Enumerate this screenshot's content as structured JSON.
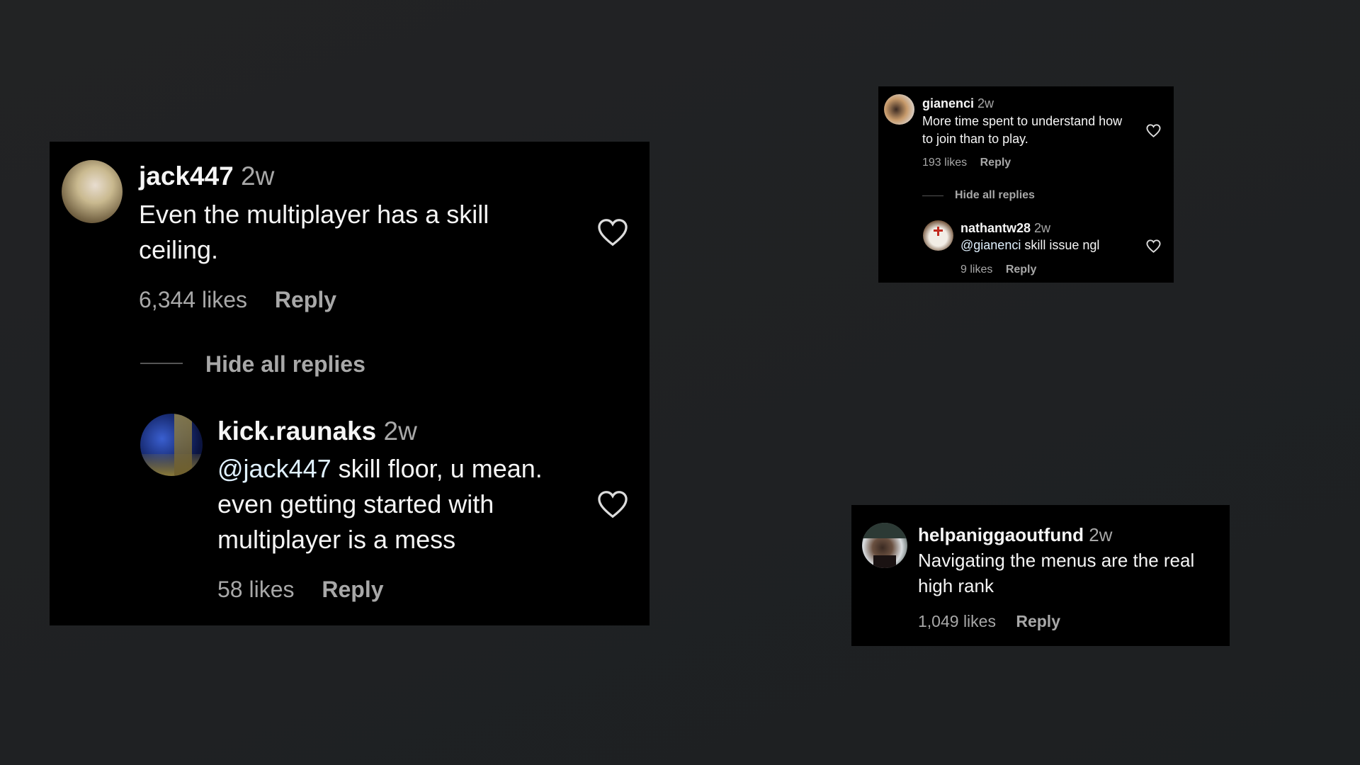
{
  "comments": [
    {
      "username": "jack447",
      "time": "2w",
      "text_lines": [
        "Even the multiplayer has a skill",
        "ceiling."
      ],
      "likes": "6,344 likes",
      "reply_label": "Reply",
      "hide_replies_label": "Hide all replies",
      "avatar_colors": [
        "#c9b98f",
        "#6b5a3c",
        "#e8ddd0"
      ],
      "replies": [
        {
          "username": "kick.raunaks",
          "time": "2w",
          "mention": "@jack447",
          "text_lines": [
            " skill floor, u mean.",
            "even getting started with",
            "multiplayer is a mess"
          ],
          "likes": "58 likes",
          "reply_label": "Reply",
          "avatar_colors": [
            "#1a2f7a",
            "#8a7a3a",
            "#0b1440"
          ]
        }
      ]
    },
    {
      "username": "gianenci",
      "time": "2w",
      "text_lines": [
        "More time spent to understand how",
        "to join than to play."
      ],
      "likes": "193 likes",
      "reply_label": "Reply",
      "hide_replies_label": "Hide all replies",
      "avatar_colors": [
        "#c79a6a",
        "#3b2a22",
        "#dfe3ea"
      ],
      "replies": [
        {
          "username": "nathantw28",
          "time": "2w",
          "mention": "@gianenci",
          "text_lines": [
            " skill issue ngl"
          ],
          "likes": "9 likes",
          "reply_label": "Reply",
          "avatar_colors": [
            "#6a4a30",
            "#f2ede6",
            "#c22a1f"
          ]
        }
      ]
    },
    {
      "username": "helpaniggaoutfund",
      "time": "2w",
      "text_lines": [
        "Navigating the menus are the real",
        "high rank"
      ],
      "likes": "1,049 likes",
      "reply_label": "Reply",
      "avatar_colors": [
        "#2c3a35",
        "#d9dde0",
        "#3a2a22"
      ]
    }
  ],
  "colors": {
    "background": "#202224",
    "panel": "#000000",
    "primary_text": "#f5f5f5",
    "secondary_text": "#a8a8a8"
  }
}
